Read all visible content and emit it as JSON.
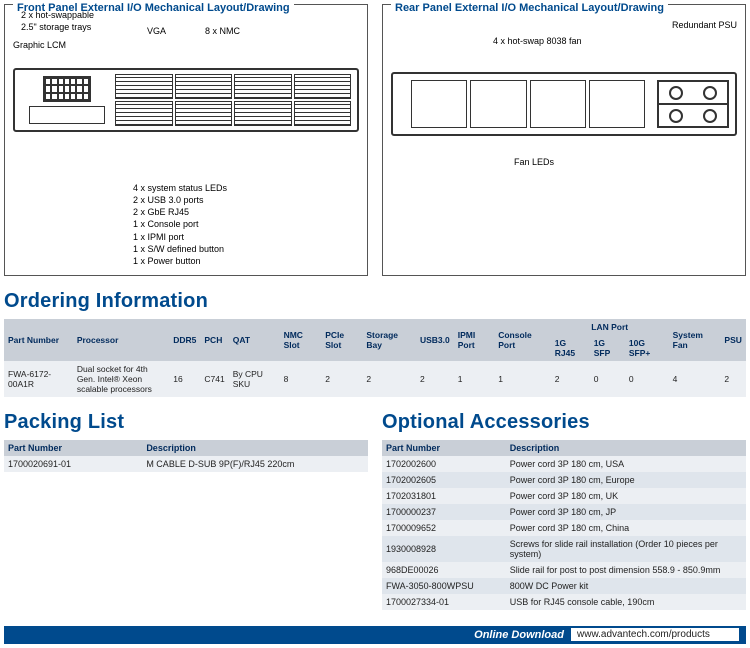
{
  "panels": {
    "front": {
      "title": "Front Panel External I/O Mechanical Layout/Drawing",
      "c_trays": "2 x hot-swappable\n2.5\" storage trays",
      "c_lcm": "Graphic LCM",
      "c_vga": "VGA",
      "c_nmc": "8 x NMC",
      "list": [
        "4 x system status LEDs",
        "2 x USB 3.0 ports",
        "2 x GbE RJ45",
        "1 x Console port",
        "1 x IPMI port",
        "1 x S/W defined button",
        "1 x Power button"
      ]
    },
    "rear": {
      "title": "Rear Panel External I/O Mechanical Layout/Drawing",
      "c_fan": "4 x hot-swap 8038 fan",
      "c_psu": "Redundant PSU",
      "c_fanled": "Fan LEDs"
    }
  },
  "sections": {
    "ordering": "Ordering Information",
    "packing": "Packing List",
    "accessories": "Optional Accessories"
  },
  "ordering": {
    "headers": {
      "pn": "Part Number",
      "proc": "Processor",
      "ddr5": "DDR5",
      "pch": "PCH",
      "qat": "QAT",
      "nmc": "NMC Slot",
      "pcie": "PCIe Slot",
      "storage": "Storage Bay",
      "usb": "USB3.0",
      "ipmi": "IPMI Port",
      "console": "Console Port",
      "lan_group": "LAN Port",
      "lan_rj45": "1G RJ45",
      "lan_sfp": "1G SFP",
      "lan_sfpp": "10G SFP+",
      "sysfan": "System Fan",
      "psu": "PSU"
    },
    "row": {
      "pn": "FWA-6172-00A1R",
      "proc": "Dual socket for 4th Gen. Intel® Xeon scalable processors",
      "ddr5": "16",
      "pch": "C741",
      "qat": "By CPU SKU",
      "nmc": "8",
      "pcie": "2",
      "storage": "2",
      "usb": "2",
      "ipmi": "1",
      "console": "1",
      "lan_rj45": "2",
      "lan_sfp": "0",
      "lan_sfpp": "0",
      "sysfan": "4",
      "psu": "2"
    }
  },
  "packing": {
    "headers": {
      "pn": "Part Number",
      "desc": "Description"
    },
    "rows": [
      {
        "pn": "1700020691-01",
        "desc": "M CABLE D-SUB 9P(F)/RJ45 220cm"
      }
    ]
  },
  "accessories": {
    "headers": {
      "pn": "Part Number",
      "desc": "Description"
    },
    "rows": [
      {
        "pn": "1702002600",
        "desc": "Power cord 3P 180 cm, USA"
      },
      {
        "pn": "1702002605",
        "desc": "Power cord 3P 180 cm, Europe"
      },
      {
        "pn": "1702031801",
        "desc": "Power cord 3P 180 cm, UK"
      },
      {
        "pn": "1700000237",
        "desc": "Power cord 3P 180 cm, JP"
      },
      {
        "pn": "1700009652",
        "desc": "Power cord 3P 180 cm, China"
      },
      {
        "pn": "1930008928",
        "desc": "Screws for slide rail installation (Order 10 pieces per system)"
      },
      {
        "pn": "968DE00026",
        "desc": "Slide rail for post to post dimension 558.9 - 850.9mm"
      },
      {
        "pn": "FWA-3050-800WPSU",
        "desc": "800W DC Power kit"
      },
      {
        "pn": "1700027334-01",
        "desc": "USB for RJ45 console cable, 190cm"
      }
    ]
  },
  "download": {
    "label": "Online Download",
    "url": "www.advantech.com/products"
  }
}
